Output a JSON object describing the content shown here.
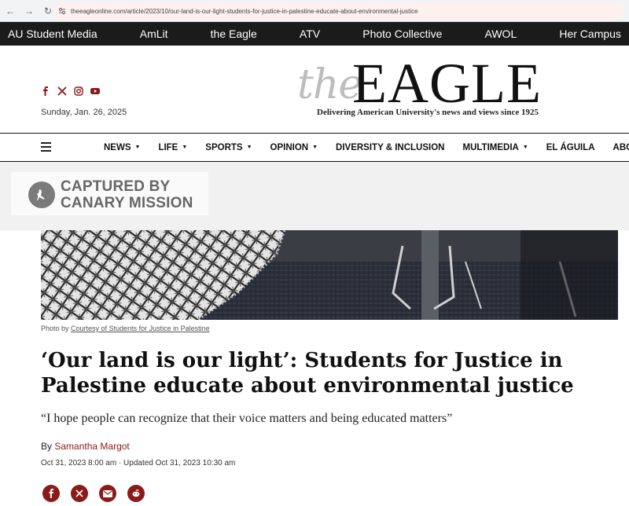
{
  "browser": {
    "url": "theeagleonline.com/article/2023/10/our-land-is-our-light-students-for-justice-in-palestine-educate-about-environmental-justice"
  },
  "network_bar": {
    "items": [
      "AU Student Media",
      "AmLit",
      "the Eagle",
      "ATV",
      "Photo Collective",
      "AWOL",
      "Her Campus"
    ]
  },
  "masthead": {
    "logo_the": "the",
    "logo_eagle": "EAGLE",
    "tagline": "Delivering American University's news and views since 1925",
    "date": "Sunday, Jan. 26, 2025",
    "social_icons": [
      "facebook-icon",
      "x-icon",
      "instagram-icon",
      "youtube-icon"
    ]
  },
  "main_nav": {
    "items": [
      {
        "label": "NEWS",
        "dropdown": true
      },
      {
        "label": "LIFE",
        "dropdown": true
      },
      {
        "label": "SPORTS",
        "dropdown": true
      },
      {
        "label": "OPINION",
        "dropdown": true
      },
      {
        "label": "DIVERSITY & INCLUSION",
        "dropdown": false
      },
      {
        "label": "MULTIMEDIA",
        "dropdown": true
      },
      {
        "label": "EL ÁGUILA",
        "dropdown": false
      },
      {
        "label": "ABOUT",
        "dropdown": true
      }
    ]
  },
  "capture": {
    "line1": "CAPTURED BY",
    "line2": "CANARY MISSION"
  },
  "photo": {
    "caption_prefix": "Photo by",
    "caption_credit": "Courtesy of Students for Justice in Palestine"
  },
  "article": {
    "headline": "‘Our land is our light’: Students for Justice in Palestine educate about environmental justice",
    "subhead": "“I hope people can recognize that their voice matters and being educated matters”",
    "by": "By",
    "author": "Samantha Margot",
    "timestamp": "Oct 31, 2023 8:00 am · Updated Oct 31, 2023 10:30 am"
  },
  "share_icons": [
    "facebook-share-icon",
    "x-share-icon",
    "email-share-icon",
    "reddit-share-icon"
  ],
  "colors": {
    "brand_red": "#8b1a1a",
    "network_bar_bg": "#1b1b1b",
    "capture_bg": "#f1f1f1"
  }
}
